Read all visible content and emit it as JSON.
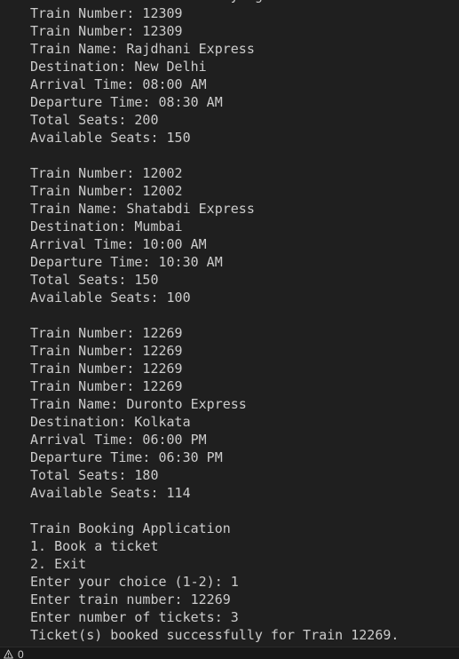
{
  "terminal": {
    "lines": [
      "Invalid choice. Please try again.",
      "Train Number: 12309",
      "Train Number: 12309",
      "Train Name: Rajdhani Express",
      "Destination: New Delhi",
      "Arrival Time: 08:00 AM",
      "Departure Time: 08:30 AM",
      "Total Seats: 200",
      "Available Seats: 150",
      "",
      "Train Number: 12002",
      "Train Number: 12002",
      "Train Name: Shatabdi Express",
      "Destination: Mumbai",
      "Arrival Time: 10:00 AM",
      "Departure Time: 10:30 AM",
      "Total Seats: 150",
      "Available Seats: 100",
      "",
      "Train Number: 12269",
      "Train Number: 12269",
      "Train Number: 12269",
      "Train Number: 12269",
      "Train Name: Duronto Express",
      "Destination: Kolkata",
      "Arrival Time: 06:00 PM",
      "Departure Time: 06:30 PM",
      "Total Seats: 180",
      "Available Seats: 114",
      "",
      "Train Booking Application",
      "1. Book a ticket",
      "2. Exit",
      "Enter your choice (1-2): 1",
      "Enter train number: 12269",
      "Enter number of tickets: 3",
      "Ticket(s) booked successfully for Train 12269."
    ]
  },
  "status_bar": {
    "problems_icon": "warning-icon",
    "problems_count": "0"
  },
  "colors": {
    "terminal_background": "#1f1f1f",
    "terminal_text": "#cccccc",
    "status_bar_background": "#181818"
  }
}
